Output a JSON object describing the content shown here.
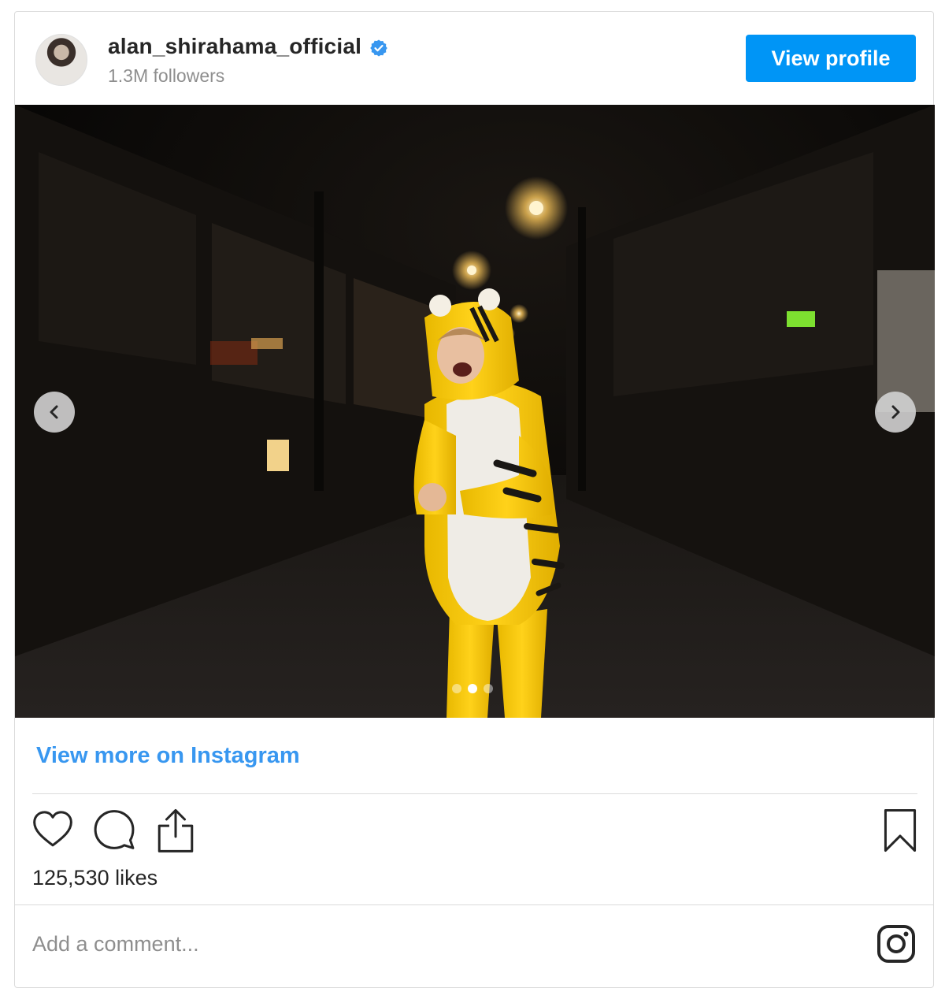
{
  "header": {
    "username": "alan_shirahama_official",
    "followers": "1.3M followers",
    "view_profile_label": "View profile"
  },
  "carousel": {
    "slide_count": 3,
    "active_slide": 2
  },
  "footer": {
    "view_more_label": "View more on Instagram",
    "likes": "125,530 likes",
    "comment_placeholder": "Add a comment..."
  },
  "colors": {
    "accent_blue": "#0095f6",
    "link_blue": "#3897f0",
    "verified_blue": "#3897f0"
  }
}
